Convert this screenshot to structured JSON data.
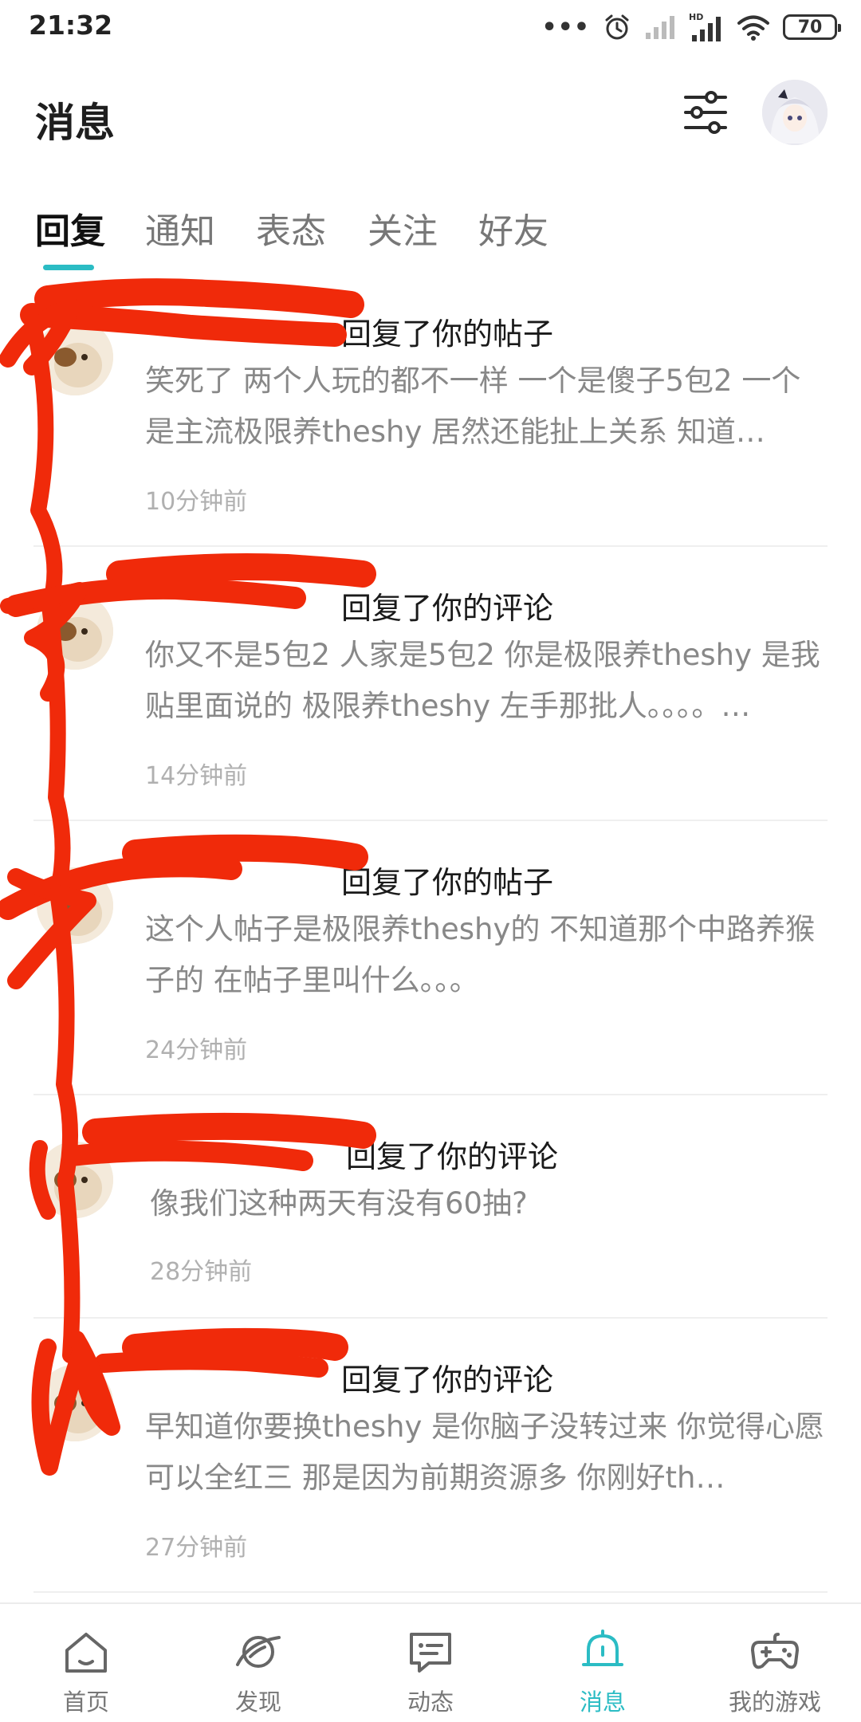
{
  "status_bar": {
    "time": "21:32",
    "dots": "•••",
    "battery": "70"
  },
  "header": {
    "title": "消息"
  },
  "tabs": [
    {
      "label": "回复",
      "active": true
    },
    {
      "label": "通知",
      "active": false
    },
    {
      "label": "表态",
      "active": false
    },
    {
      "label": "关注",
      "active": false
    },
    {
      "label": "好友",
      "active": false
    }
  ],
  "replies": [
    {
      "action": "回复了你的帖子",
      "body": "笑死了 两个人玩的都不一样 一个是傻子5包2 一个是主流极限养theshy 居然还能扯上关系 知道…",
      "time": "10分钟前"
    },
    {
      "action": "回复了你的评论",
      "body": "你又不是5包2 人家是5包2 你是极限养theshy 是我贴里面说的 极限养theshy 左手那批人。。。。…",
      "time": "14分钟前"
    },
    {
      "action": "回复了你的帖子",
      "body": "这个人帖子是极限养theshy的 不知道那个中路养猴子的 在帖子里叫什么。。。",
      "time": "24分钟前"
    },
    {
      "action": "回复了你的评论",
      "body": "像我们这种两天有没有60抽?",
      "time": "28分钟前"
    },
    {
      "action": "回复了你的评论",
      "body": "早知道你要换theshy 是你脑子没转过来   你觉得心愿可以全红三 那是因为前期资源多 你刚好th…",
      "time": "27分钟前"
    }
  ],
  "bottom_nav": [
    {
      "label": "首页",
      "icon": "home-icon",
      "active": false
    },
    {
      "label": "发现",
      "icon": "planet-icon",
      "active": false
    },
    {
      "label": "动态",
      "icon": "chat-bubble-icon",
      "active": false
    },
    {
      "label": "消息",
      "icon": "bell-icon",
      "active": true
    },
    {
      "label": "我的游戏",
      "icon": "gamepad-icon",
      "active": false
    }
  ],
  "colors": {
    "accent": "#2bbcc4",
    "scribble": "#f02a0a"
  }
}
